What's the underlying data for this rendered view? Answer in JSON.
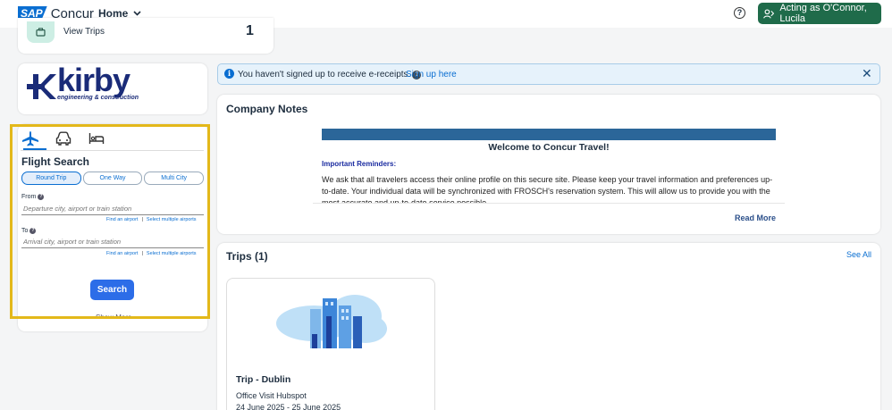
{
  "header": {
    "logo_sap": "SAP",
    "logo_concur": "Concur",
    "home_label": "Home",
    "acting_as": "Acting as O'Connor, Lucila"
  },
  "view_trips": {
    "label": "View Trips",
    "count": "1"
  },
  "company_logo": {
    "name": "kirby",
    "tagline": "engineering & construction"
  },
  "flight_search": {
    "title": "Flight Search",
    "trip_types": [
      "Round Trip",
      "One Way",
      "Multi City"
    ],
    "selected_trip_type": "Round Trip",
    "from_label": "From",
    "from_placeholder": "Departure city, airport or train station",
    "to_label": "To",
    "to_placeholder": "Arrival city, airport or train station",
    "find_airport": "Find an airport",
    "select_multiple": "Select multiple airports",
    "search_label": "Search",
    "show_more": "Show More"
  },
  "ereceipt": {
    "message": "You haven't signed up to receive e-receipts.",
    "link": "Sign up here"
  },
  "company_notes": {
    "title": "Company Notes",
    "welcome": "Welcome to Concur Travel!",
    "reminders_heading": "Important Reminders:",
    "body": "We ask that all travelers access their online profile on this secure site.  Please keep your travel information and preferences up-to-date. Your individual data will be synchronized with FROSCH's reservation system. This will allow us to provide you with the most accurate and up-to-date service possible.",
    "read_more": "Read More"
  },
  "trips": {
    "title": "Trips (1)",
    "see_all": "See All",
    "items": [
      {
        "name": "Trip - Dublin",
        "purpose": "Office Visit Hubspot",
        "dates": "24 June 2025 - 25 June 2025"
      }
    ]
  },
  "colors": {
    "brand_blue": "#0a6ed1",
    "acting_green": "#1f6b4a",
    "highlight": "#e3b81a"
  }
}
